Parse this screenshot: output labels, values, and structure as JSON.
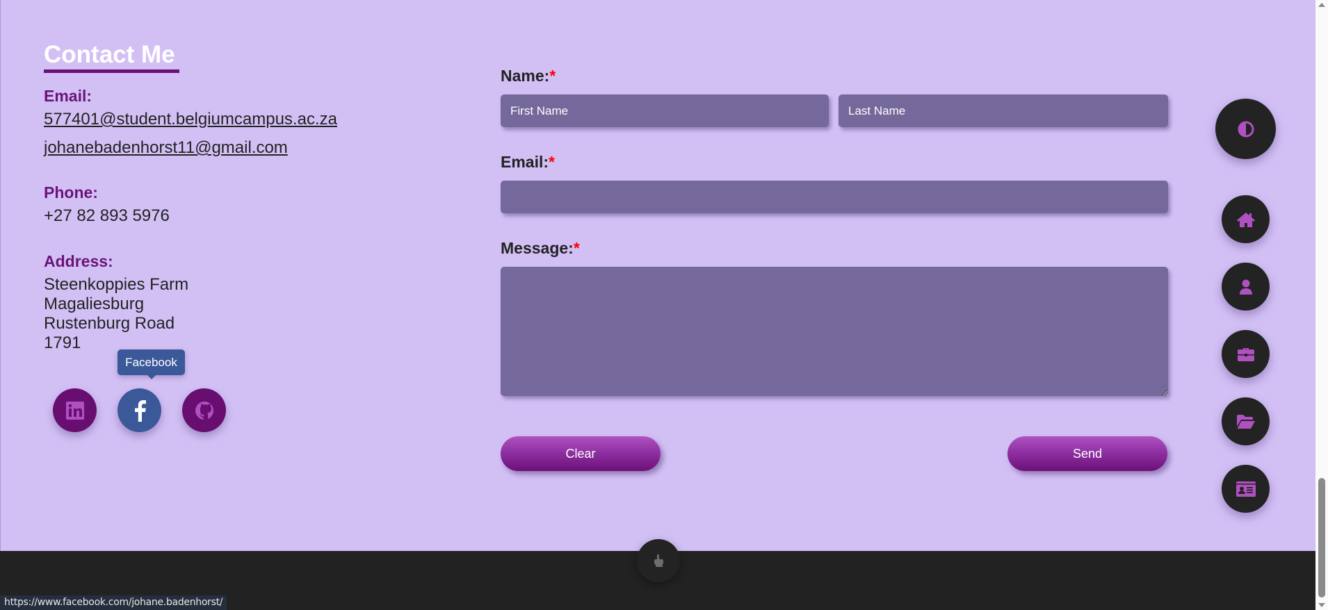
{
  "contact": {
    "title": "Contact Me",
    "email_label": "Email:",
    "emails": [
      "577401@student.belgiumcampus.ac.za",
      "johanebadenhorst11@gmail.com"
    ],
    "phone_label": "Phone:",
    "phone": "+27 82 893 5976",
    "address_label": "Address:",
    "address_lines": [
      "Steenkoppies Farm",
      "Magaliesburg",
      "Rustenburg Road",
      "1791"
    ]
  },
  "social": {
    "tooltip": "Facebook",
    "items": [
      {
        "name": "LinkedIn",
        "icon": "linkedin-icon",
        "color": "#680e70"
      },
      {
        "name": "Facebook",
        "icon": "facebook-icon",
        "color": "#3b5998"
      },
      {
        "name": "GitHub",
        "icon": "github-icon",
        "color": "#680e70"
      }
    ]
  },
  "form": {
    "name_label": "Name:",
    "email_label": "Email:",
    "message_label": "Message:",
    "required_marker": "*",
    "first_name_placeholder": "First Name",
    "last_name_placeholder": "Last Name",
    "email_value": "",
    "message_value": "",
    "clear_label": "Clear",
    "send_label": "Send"
  },
  "nav": {
    "theme_toggle": "contrast-icon",
    "items": [
      {
        "name": "Home",
        "icon": "home-icon"
      },
      {
        "name": "About",
        "icon": "user-icon"
      },
      {
        "name": "Experience",
        "icon": "briefcase-icon"
      },
      {
        "name": "Projects",
        "icon": "folder-open-icon"
      },
      {
        "name": "Contact",
        "icon": "id-card-icon"
      }
    ]
  },
  "status_bar": {
    "url": "https://www.facebook.com/johane.badenhorst/"
  },
  "colors": {
    "background": "#d2c0f5",
    "accent": "#b051c2",
    "dark": "#232323",
    "field": "#75689b",
    "label_purple": "#6a1478"
  }
}
